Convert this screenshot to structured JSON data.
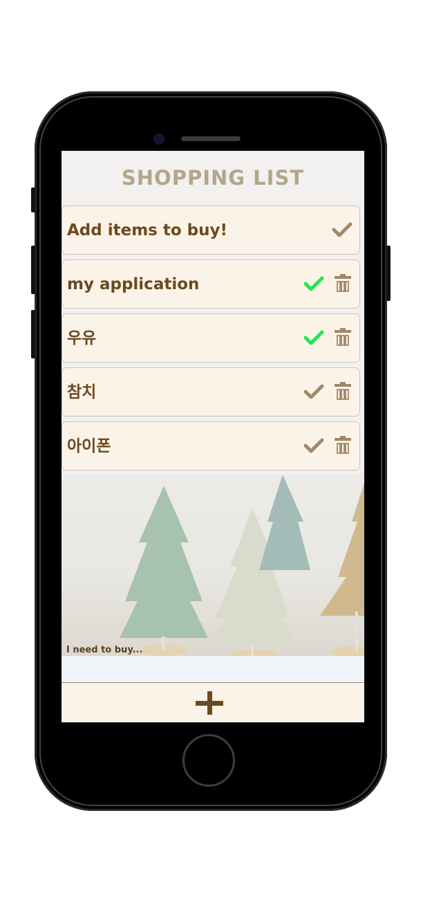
{
  "app": {
    "title": "SHOPPING LIST"
  },
  "items": [
    {
      "label": "Add items to buy!",
      "checked": false,
      "deletable": false
    },
    {
      "label": "my application",
      "checked": true,
      "deletable": true
    },
    {
      "label": "우유",
      "checked": true,
      "deletable": true
    },
    {
      "label": "참치",
      "checked": false,
      "deletable": true
    },
    {
      "label": "아이폰",
      "checked": false,
      "deletable": true
    }
  ],
  "input": {
    "label": "I need to buy...",
    "value": ""
  },
  "icons": {
    "check": "check-icon",
    "delete": "trash-icon",
    "add": "plus-icon"
  },
  "colors": {
    "title": "#b2a789",
    "item_background": "#fcf3e8",
    "item_text": "#6b4a22",
    "check_done": "#1ee84e",
    "check_pending": "#a08868",
    "trash": "#a08868",
    "add_icon": "#6b4a22",
    "input_background": "#eef5fb"
  }
}
